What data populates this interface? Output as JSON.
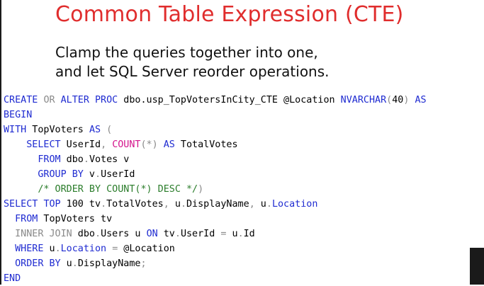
{
  "slide": {
    "title": "Common Table Expression (CTE)",
    "subtitle_lines": [
      "Clamp the queries together into one,",
      "and let SQL Server reorder operations."
    ]
  },
  "code": {
    "lines": [
      [
        {
          "t": "CREATE",
          "c": "kw"
        },
        {
          "t": " ",
          "c": "tx"
        },
        {
          "t": "OR",
          "c": "gy"
        },
        {
          "t": " ",
          "c": "tx"
        },
        {
          "t": "ALTER",
          "c": "kw"
        },
        {
          "t": " ",
          "c": "tx"
        },
        {
          "t": "PROC",
          "c": "kw"
        },
        {
          "t": " dbo.usp_TopVotersInCity_CTE @Location ",
          "c": "tx"
        },
        {
          "t": "NVARCHAR",
          "c": "kw"
        },
        {
          "t": "(",
          "c": "gy"
        },
        {
          "t": "40",
          "c": "num"
        },
        {
          "t": ")",
          "c": "gy"
        },
        {
          "t": " ",
          "c": "tx"
        },
        {
          "t": "AS",
          "c": "kw"
        }
      ],
      [
        {
          "t": "BEGIN",
          "c": "kw"
        }
      ],
      [
        {
          "t": "WITH",
          "c": "kw"
        },
        {
          "t": " TopVoters ",
          "c": "tx"
        },
        {
          "t": "AS",
          "c": "kw"
        },
        {
          "t": " (",
          "c": "gy"
        }
      ],
      [
        {
          "t": "    ",
          "c": "tx"
        },
        {
          "t": "SELECT",
          "c": "kw"
        },
        {
          "t": " UserId",
          "c": "tx"
        },
        {
          "t": ",",
          "c": "gy"
        },
        {
          "t": " ",
          "c": "tx"
        },
        {
          "t": "COUNT",
          "c": "fn"
        },
        {
          "t": "(*)",
          "c": "gy"
        },
        {
          "t": " ",
          "c": "tx"
        },
        {
          "t": "AS",
          "c": "kw"
        },
        {
          "t": " TotalVotes",
          "c": "tx"
        }
      ],
      [
        {
          "t": "      ",
          "c": "tx"
        },
        {
          "t": "FROM",
          "c": "kw"
        },
        {
          "t": " dbo",
          "c": "tx"
        },
        {
          "t": ".",
          "c": "gy"
        },
        {
          "t": "Votes v",
          "c": "tx"
        }
      ],
      [
        {
          "t": "      ",
          "c": "tx"
        },
        {
          "t": "GROUP",
          "c": "kw"
        },
        {
          "t": " ",
          "c": "tx"
        },
        {
          "t": "BY",
          "c": "kw"
        },
        {
          "t": " v",
          "c": "tx"
        },
        {
          "t": ".",
          "c": "gy"
        },
        {
          "t": "UserId",
          "c": "tx"
        }
      ],
      [
        {
          "t": "      ",
          "c": "tx"
        },
        {
          "t": "/* ORDER BY COUNT(*) DESC */",
          "c": "cm"
        },
        {
          "t": ")",
          "c": "gy"
        }
      ],
      [
        {
          "t": "SELECT",
          "c": "kw"
        },
        {
          "t": " ",
          "c": "tx"
        },
        {
          "t": "TOP",
          "c": "kw"
        },
        {
          "t": " 100 tv",
          "c": "tx"
        },
        {
          "t": ".",
          "c": "gy"
        },
        {
          "t": "TotalVotes",
          "c": "tx"
        },
        {
          "t": ",",
          "c": "gy"
        },
        {
          "t": " u",
          "c": "tx"
        },
        {
          "t": ".",
          "c": "gy"
        },
        {
          "t": "DisplayName",
          "c": "tx"
        },
        {
          "t": ",",
          "c": "gy"
        },
        {
          "t": " u",
          "c": "tx"
        },
        {
          "t": ".",
          "c": "gy"
        },
        {
          "t": "Location",
          "c": "kw"
        }
      ],
      [
        {
          "t": "  ",
          "c": "tx"
        },
        {
          "t": "FROM",
          "c": "kw"
        },
        {
          "t": " TopVoters tv",
          "c": "tx"
        }
      ],
      [
        {
          "t": "  ",
          "c": "tx"
        },
        {
          "t": "INNER",
          "c": "gy"
        },
        {
          "t": " ",
          "c": "tx"
        },
        {
          "t": "JOIN",
          "c": "gy"
        },
        {
          "t": " dbo",
          "c": "tx"
        },
        {
          "t": ".",
          "c": "gy"
        },
        {
          "t": "Users u ",
          "c": "tx"
        },
        {
          "t": "ON",
          "c": "kw"
        },
        {
          "t": " tv",
          "c": "tx"
        },
        {
          "t": ".",
          "c": "gy"
        },
        {
          "t": "UserId ",
          "c": "tx"
        },
        {
          "t": "=",
          "c": "gy"
        },
        {
          "t": " u",
          "c": "tx"
        },
        {
          "t": ".",
          "c": "gy"
        },
        {
          "t": "Id",
          "c": "tx"
        }
      ],
      [
        {
          "t": "  ",
          "c": "tx"
        },
        {
          "t": "WHERE",
          "c": "kw"
        },
        {
          "t": " u",
          "c": "tx"
        },
        {
          "t": ".",
          "c": "gy"
        },
        {
          "t": "Location",
          "c": "kw"
        },
        {
          "t": " ",
          "c": "tx"
        },
        {
          "t": "=",
          "c": "gy"
        },
        {
          "t": " @Location",
          "c": "tx"
        }
      ],
      [
        {
          "t": "  ",
          "c": "tx"
        },
        {
          "t": "ORDER",
          "c": "kw"
        },
        {
          "t": " ",
          "c": "tx"
        },
        {
          "t": "BY",
          "c": "kw"
        },
        {
          "t": " u",
          "c": "tx"
        },
        {
          "t": ".",
          "c": "gy"
        },
        {
          "t": "DisplayName",
          "c": "tx"
        },
        {
          "t": ";",
          "c": "gy"
        }
      ],
      [
        {
          "t": "END",
          "c": "kw"
        }
      ]
    ]
  },
  "colors": {
    "title": "#e02d2d",
    "keyword": "#1f2bd1",
    "operator": "#8a8a8a",
    "function": "#d4148c",
    "comment": "#2b7d2b"
  }
}
